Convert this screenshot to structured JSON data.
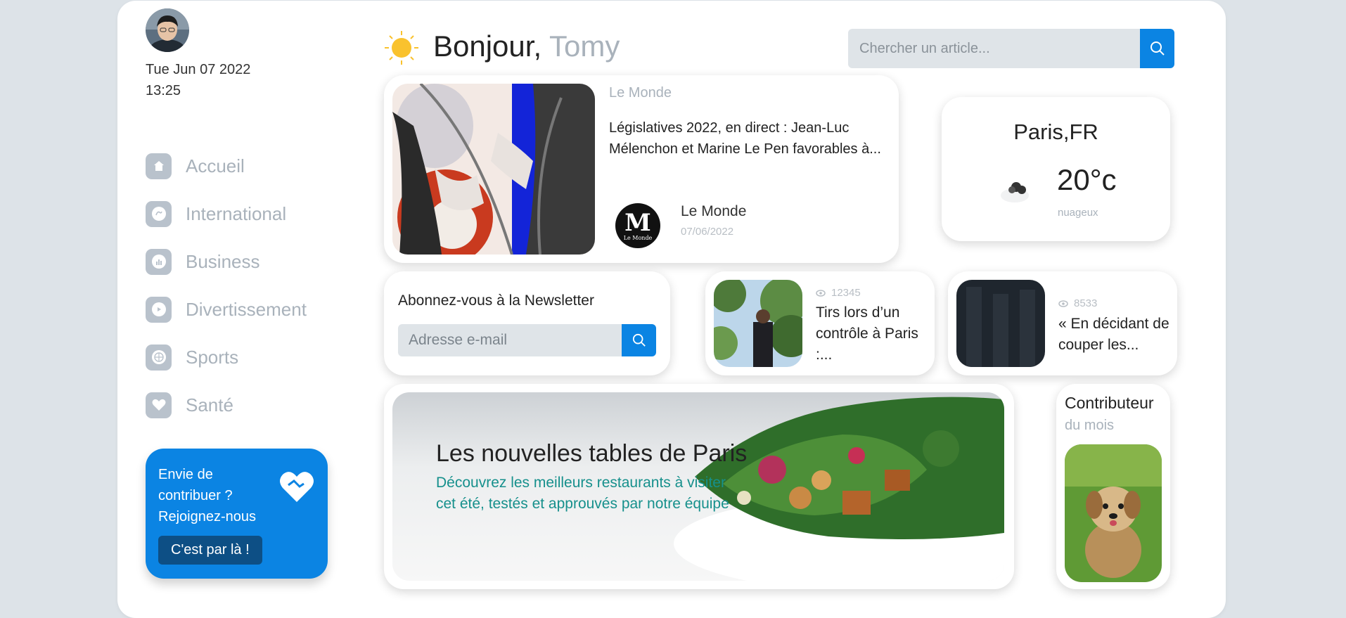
{
  "user": {
    "date": "Tue Jun 07 2022",
    "time": "13:25"
  },
  "nav": {
    "items": [
      {
        "label": "Accueil",
        "icon": "home-icon"
      },
      {
        "label": "International",
        "icon": "globe-icon"
      },
      {
        "label": "Business",
        "icon": "chart-icon"
      },
      {
        "label": "Divertissement",
        "icon": "play-icon"
      },
      {
        "label": "Sports",
        "icon": "basketball-icon"
      },
      {
        "label": "Santé",
        "icon": "heart-icon"
      }
    ]
  },
  "contribute": {
    "text": "Envie de contribuer ? Rejoignez-nous",
    "button": "C'est par là !"
  },
  "header": {
    "greeting": "Bonjour,",
    "name": "Tomy"
  },
  "search": {
    "placeholder": "Chercher un article..."
  },
  "main_article": {
    "source": "Le Monde",
    "title": "Législatives 2022, en direct : Jean-Luc Mélenchon et Marine Le Pen favorables à...",
    "author": "Le Monde",
    "date": "07/06/2022",
    "logo_letter": "M",
    "logo_text": "Le Monde"
  },
  "weather": {
    "city": "Paris,FR",
    "temp": "20°c",
    "desc": "nuageux"
  },
  "newsletter": {
    "title": "Abonnez-vous à la Newsletter",
    "placeholder": "Adresse e-mail"
  },
  "articles": [
    {
      "views": "12345",
      "title": "Tirs lors d’un contrôle à Paris :..."
    },
    {
      "views": "8533",
      "title": "« En décidant de couper les..."
    }
  ],
  "feature": {
    "title": "Les nouvelles tables de Paris",
    "subtitle": "Découvrez les meilleurs restaurants à visiter cet été, testés et approuvés par notre équipe"
  },
  "contributor": {
    "title": "Contributeur",
    "subtitle": "du mois"
  },
  "colors": {
    "accent": "#0b84e3",
    "teal": "#16908c",
    "muted": "#a9b2bb"
  }
}
